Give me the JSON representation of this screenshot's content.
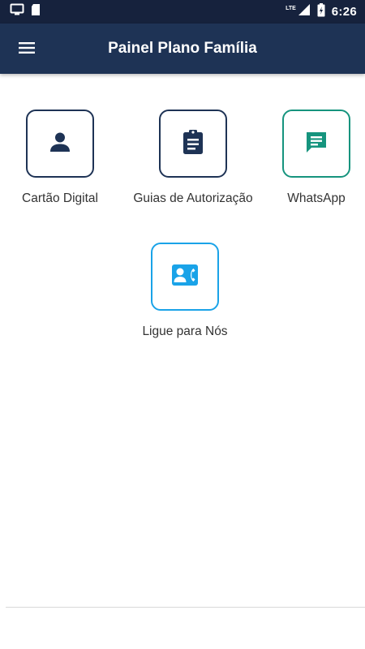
{
  "status_bar": {
    "time": "6:26",
    "network_label": "LTE",
    "icons": [
      "screen-cast-icon",
      "sd-card-icon",
      "signal-icon",
      "battery-icon"
    ]
  },
  "app_bar": {
    "title": "Painel Plano Família",
    "menu_icon": "hamburger-menu-icon"
  },
  "tiles": [
    {
      "label": "Cartão Digital",
      "icon": "person-icon",
      "accent": "#1e3355"
    },
    {
      "label": "Guias de Autorização",
      "icon": "clipboard-icon",
      "accent": "#1e3355"
    },
    {
      "label": "WhatsApp",
      "icon": "chat-icon",
      "accent": "#16947e"
    },
    {
      "label": "Ligue para Nós",
      "icon": "contact-phone-icon",
      "accent": "#1aa3e8"
    }
  ],
  "colors": {
    "status_bar": "#16223d",
    "app_bar": "#1e3355",
    "background": "#ffffff"
  }
}
